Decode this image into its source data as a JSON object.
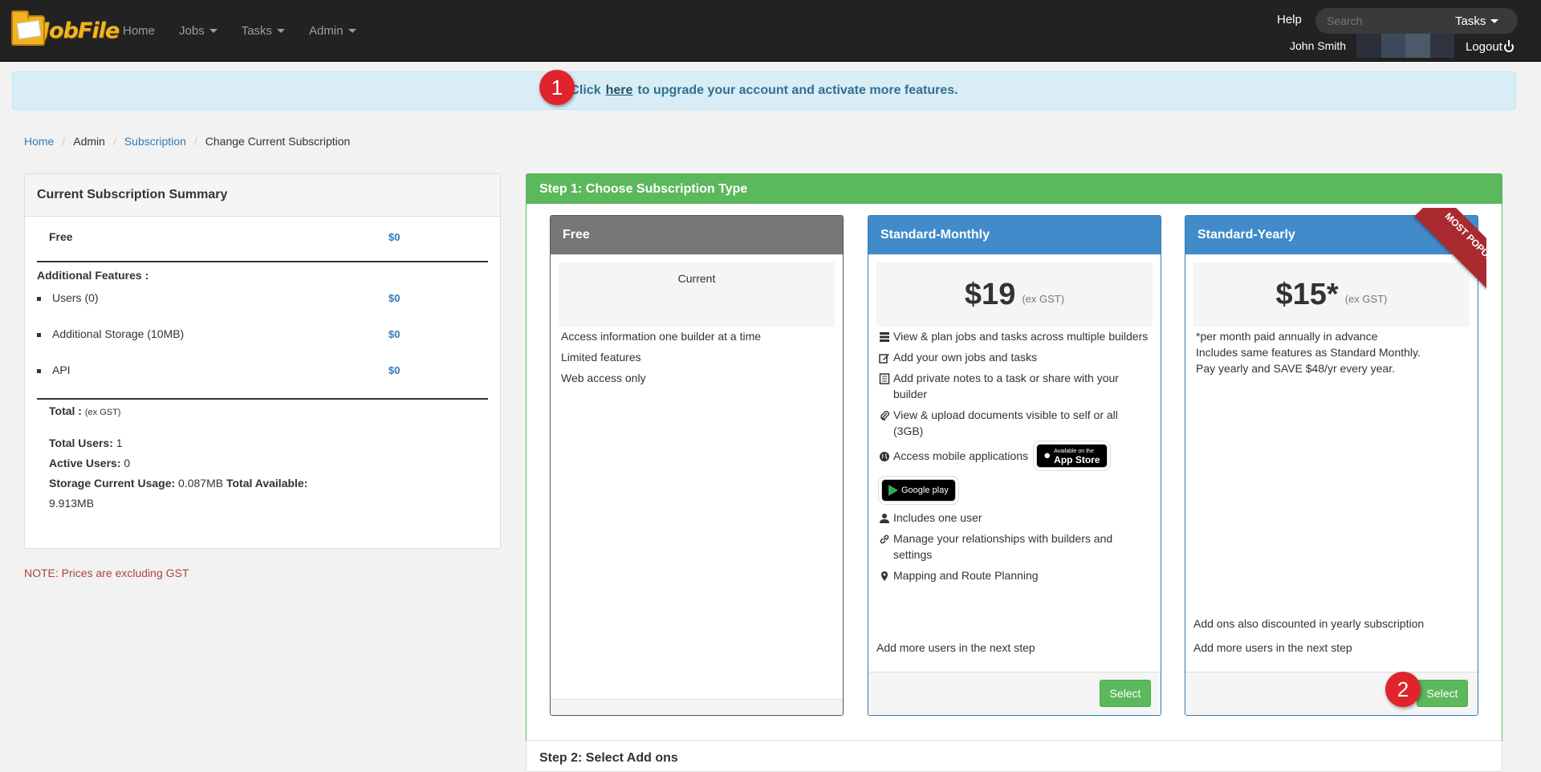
{
  "navbar": {
    "brand": "JobFile",
    "links": [
      "Home",
      "Jobs",
      "Tasks",
      "Admin"
    ],
    "help": "Help",
    "search_placeholder": "Search",
    "search_scope": "Tasks",
    "user_name": "John Smith",
    "logout": "Logout"
  },
  "alert": {
    "prefix": "Click",
    "link": "here",
    "suffix": "to upgrade your account and activate more features.",
    "badge1": "1",
    "badge2": "2"
  },
  "breadcrumb": [
    "Home",
    "Admin",
    "Subscription",
    "Change Current Subscription"
  ],
  "summary": {
    "title": "Current Subscription Summary",
    "plan_name": "Free",
    "plan_price": "$0",
    "features_label": "Additional Features :",
    "features": [
      {
        "label": "Users (0)",
        "price": "$0"
      },
      {
        "label": "Additional Storage (10MB)",
        "price": "$0"
      },
      {
        "label": "API",
        "price": "$0"
      }
    ],
    "total_label": "Total :",
    "total_gst": "(ex GST)",
    "total_users_label": "Total Users:",
    "total_users": "1",
    "active_users_label": "Active Users:",
    "active_users": "0",
    "storage_label": "Storage Current Usage:",
    "storage_usage": "0.087MB",
    "available_label": "Total Available:",
    "available": "9.913MB"
  },
  "note": "NOTE: Prices are excluding GST",
  "step1": {
    "title": "Step 1: Choose Subscription Type",
    "plans": [
      {
        "name": "Free",
        "current": "Current",
        "features": [
          "Access information one builder at a time",
          "Limited features",
          "Web access only"
        ]
      },
      {
        "name": "Standard-Monthly",
        "price": "$19",
        "gst": "(ex GST)",
        "features": [
          "View & plan jobs and tasks across multiple builders",
          "Add your own jobs and tasks",
          "Add private notes to a task or share with your builder",
          "View & upload documents visible to self or all (3GB)",
          "Access mobile applications",
          "Includes one user",
          "Manage your relationships with builders and settings",
          "Mapping and Route Planning"
        ],
        "app_store": "App Store",
        "app_store_small": "Available on the",
        "google_play": "Google play",
        "footer_note": "Add more users in the next step",
        "button": "Select"
      },
      {
        "name": "Standard-Yearly",
        "price": "$15*",
        "gst": "(ex GST)",
        "notes": [
          "*per month paid annually in advance",
          "Includes same features as Standard Monthly.",
          "Pay yearly and SAVE $48/yr every year."
        ],
        "addons_note": "Add ons also discounted in yearly subscription",
        "footer_note": "Add more users in the next step",
        "ribbon": "MOST POPULAR",
        "button": "Select"
      }
    ]
  },
  "step2": {
    "title": "Step 2: Select Add ons"
  },
  "colors": {
    "navbar": "#222222",
    "success": "#5cb85c",
    "primary": "#428bca",
    "alert_bg": "#d9edf7",
    "badge": "#e0242c",
    "ribbon": "#a92a2f"
  }
}
